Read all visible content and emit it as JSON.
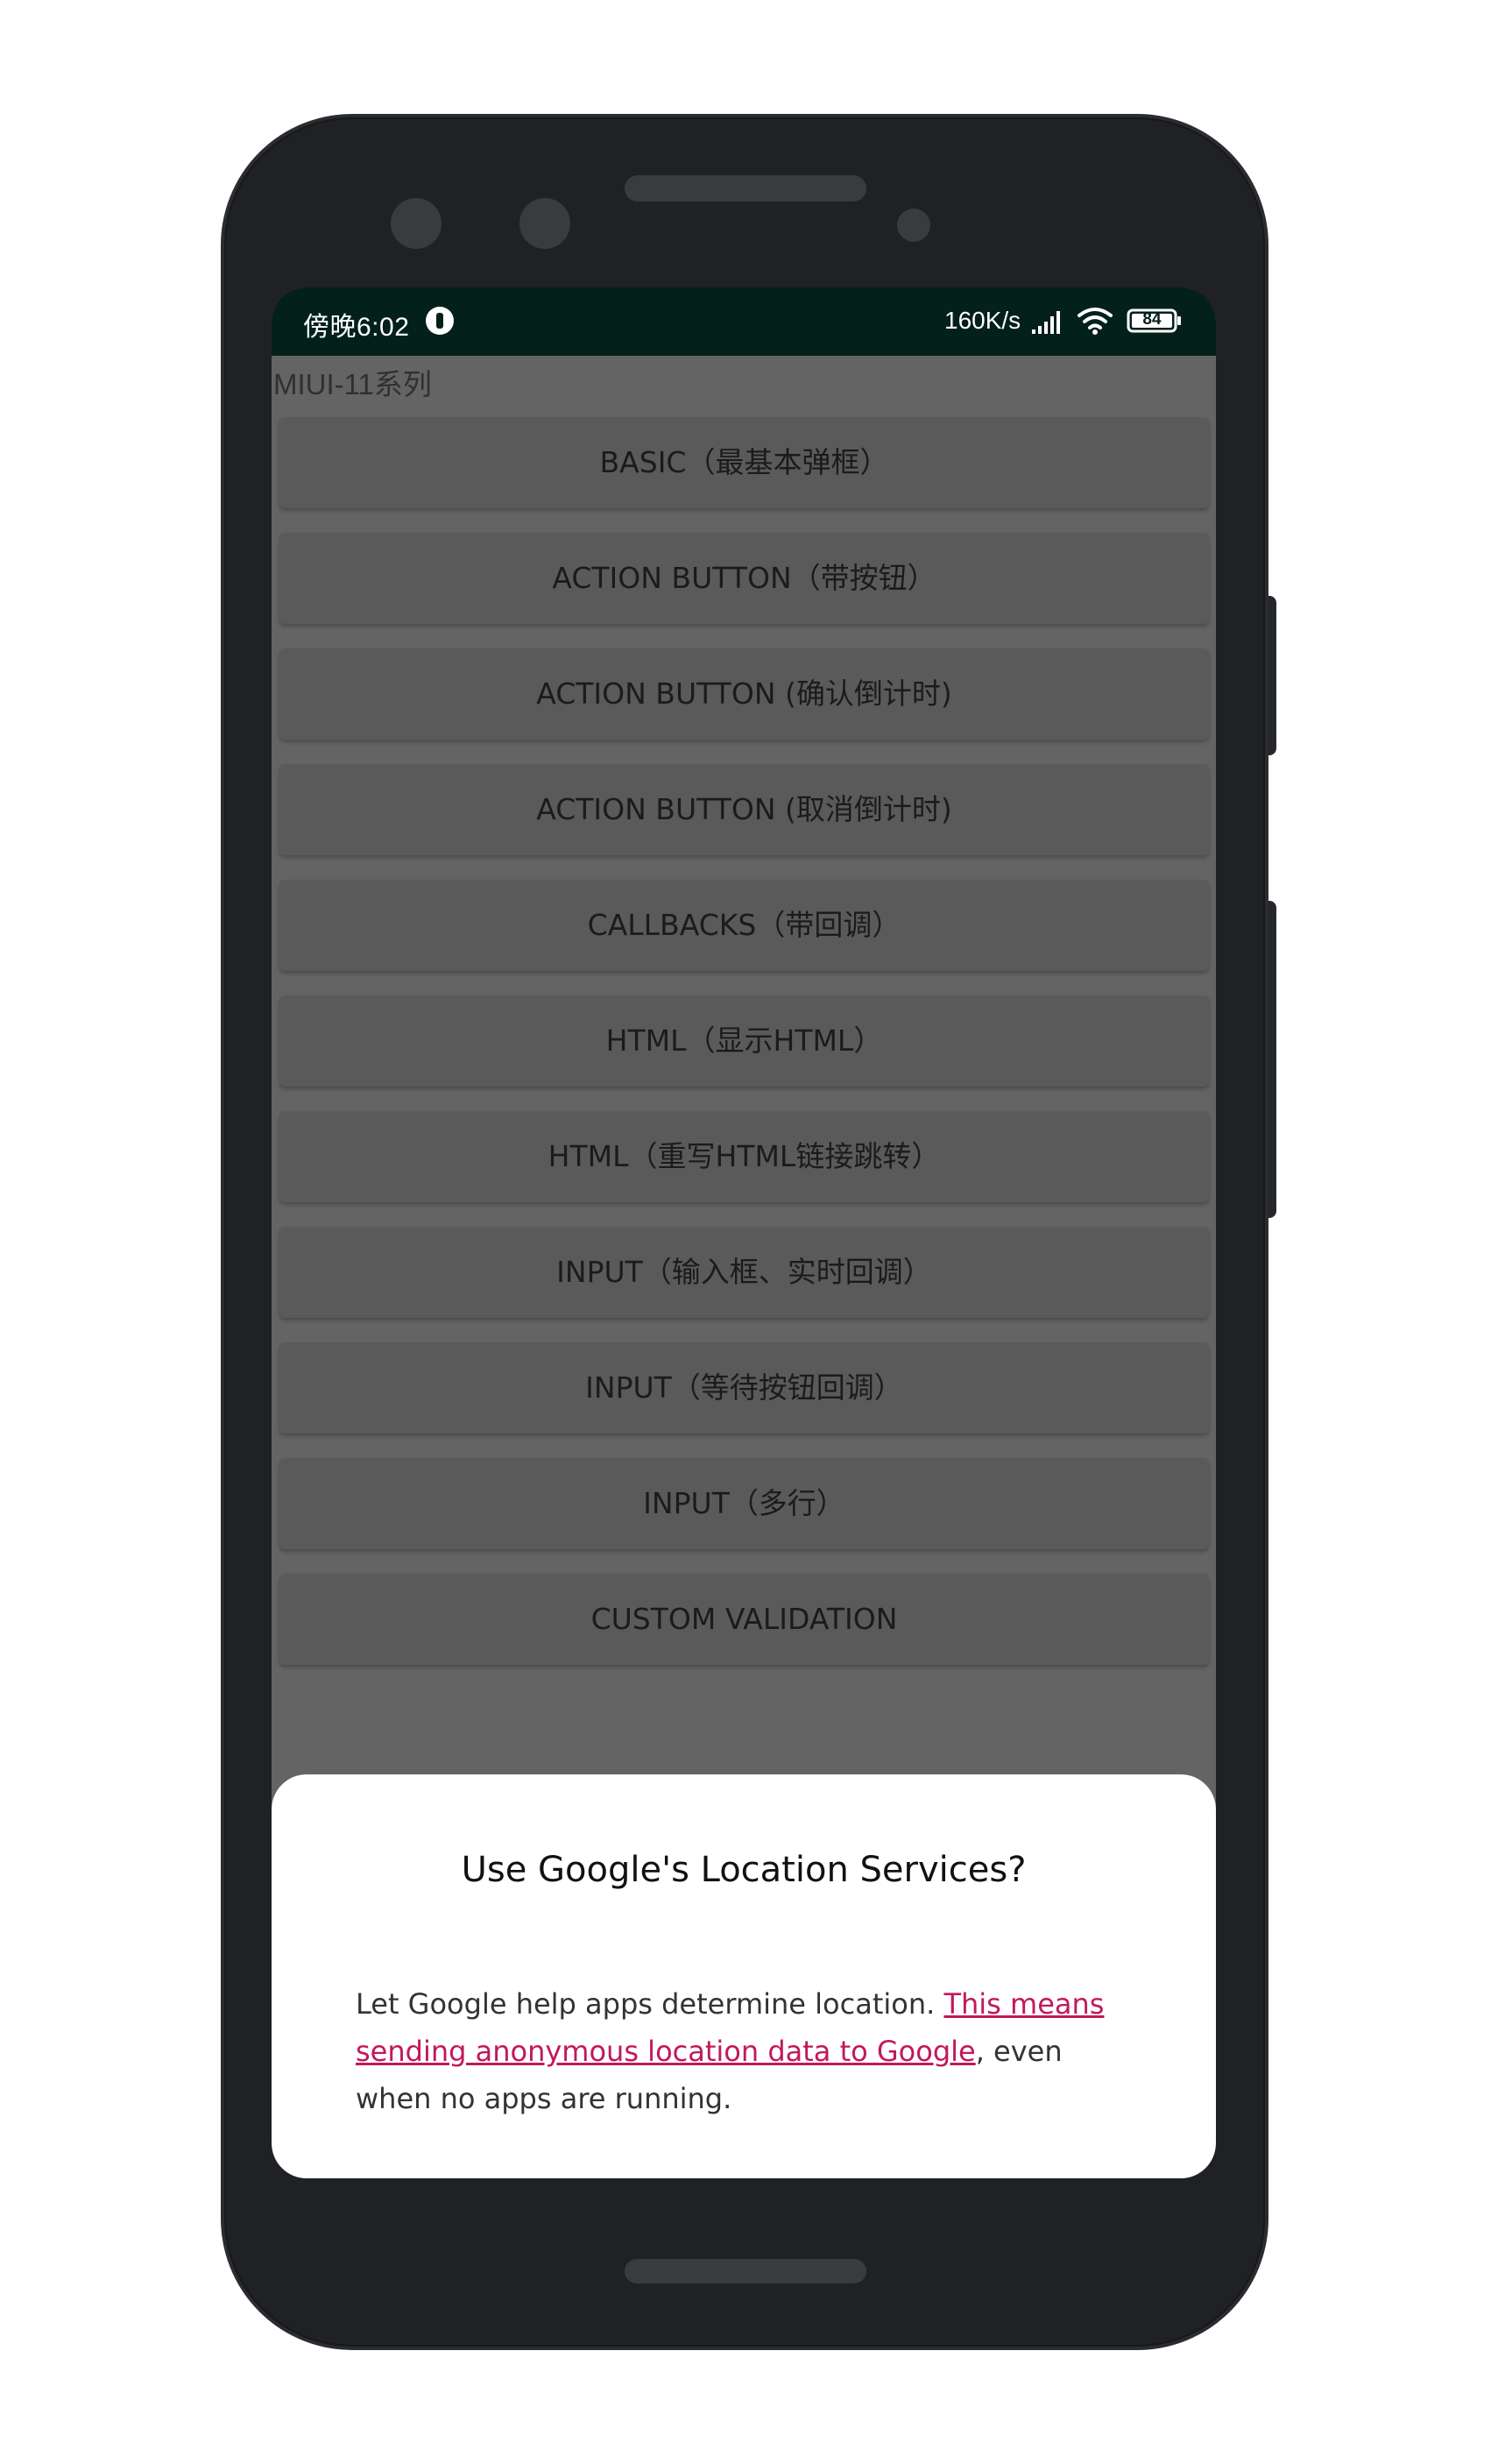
{
  "status_bar": {
    "time": "傍晚6:02",
    "speed": "160K/s",
    "battery": "84",
    "icons": [
      "app-notification-icon",
      "signal-icon",
      "wifi-icon",
      "battery-icon"
    ]
  },
  "section_title": "MIUI-11系列",
  "buttons": [
    {
      "label": "BASIC（最基本弹框）"
    },
    {
      "label": "ACTION BUTTON（带按钮）"
    },
    {
      "label": "ACTION BUTTON (确认倒计时)"
    },
    {
      "label": "ACTION BUTTON (取消倒计时)"
    },
    {
      "label": "CALLBACKS（带回调）"
    },
    {
      "label": "HTML（显示HTML）"
    },
    {
      "label": "HTML（重写HTML链接跳转）"
    },
    {
      "label": "INPUT（输入框、实时回调）"
    },
    {
      "label": "INPUT（等待按钮回调）"
    },
    {
      "label": "INPUT（多行）"
    },
    {
      "label": "CUSTOM VALIDATION"
    }
  ],
  "dialog": {
    "title": "Use Google's Location Services?",
    "message_before": "Let Google help apps determine location. ",
    "link_text": "This means sending anonymous location data to Google",
    "message_after": ", even when no apps are running."
  },
  "colors": {
    "status_bar_bg": "#03201b",
    "screen_bg": "#646464",
    "button_bg": "#5a5a5a",
    "link": "#c2185b",
    "phone_frame": "#202124"
  }
}
